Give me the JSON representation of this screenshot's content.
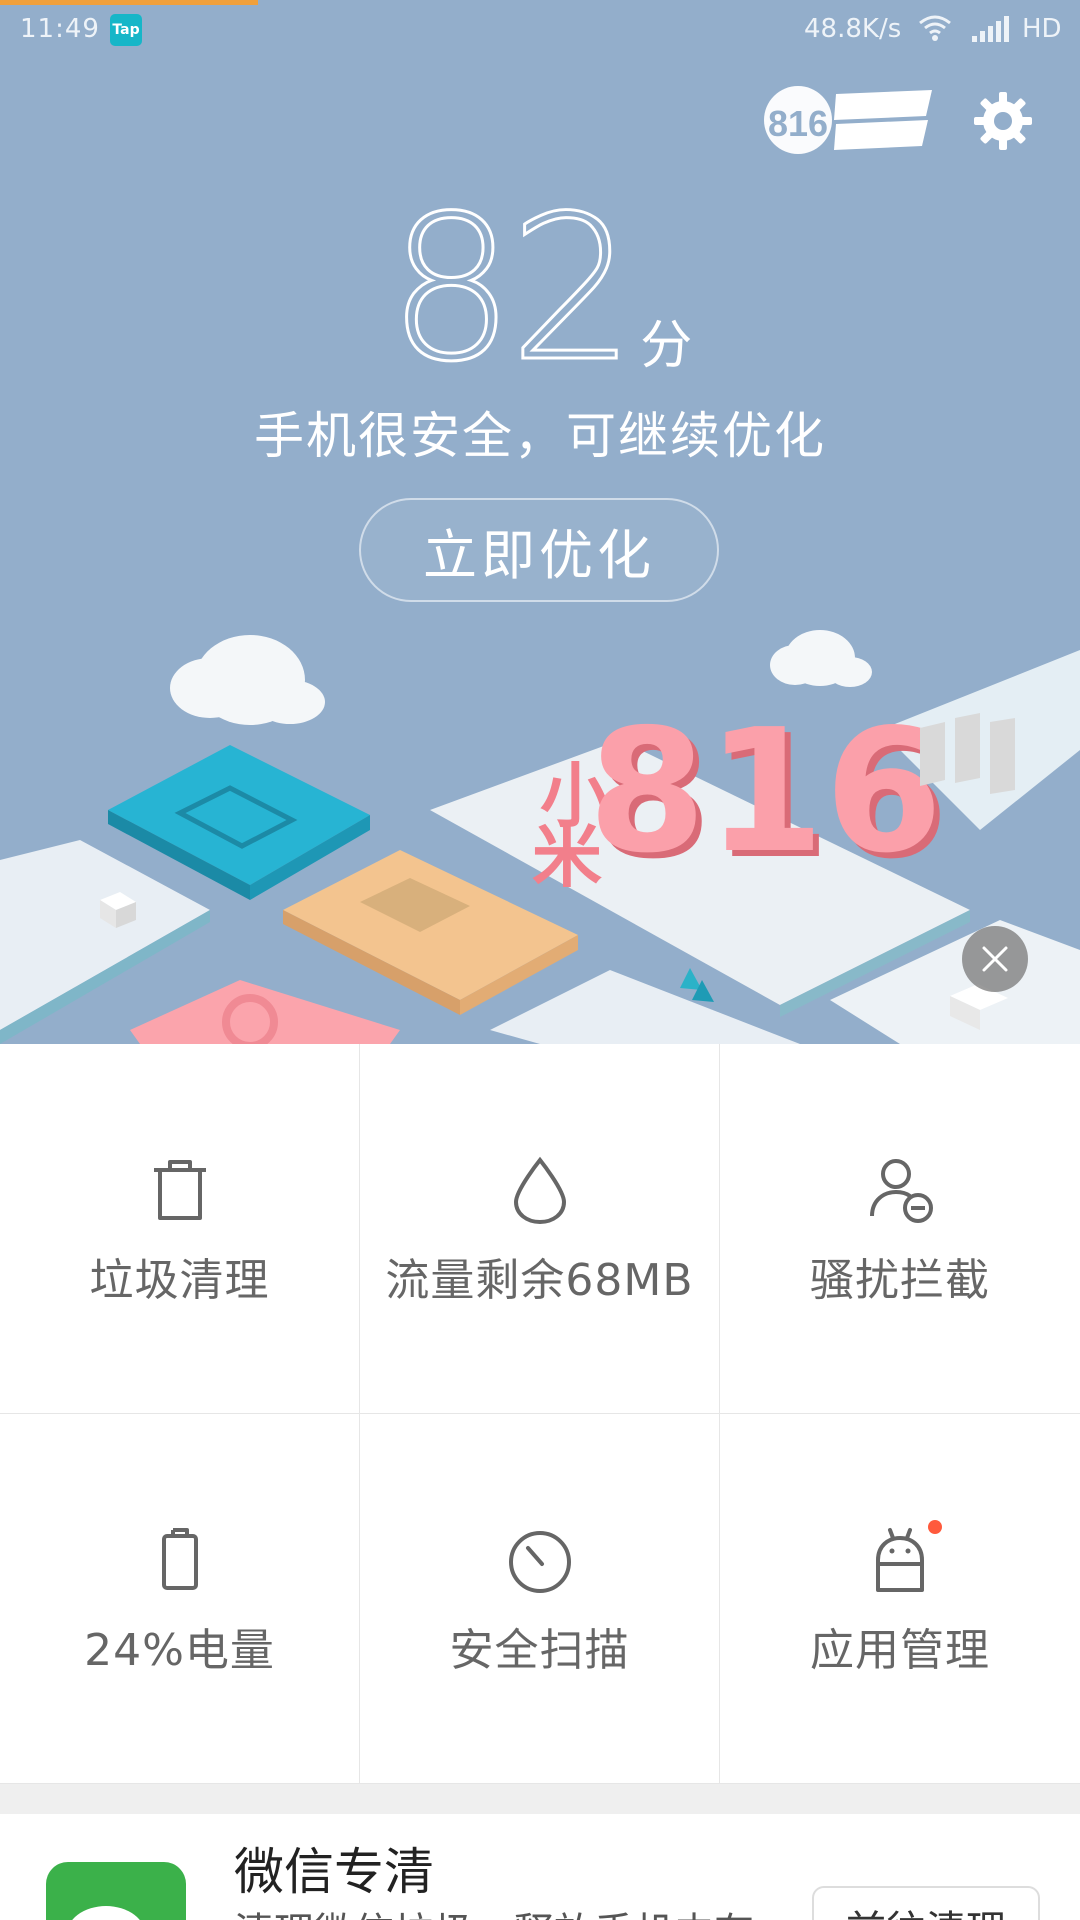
{
  "status_bar": {
    "time": "11:49",
    "tap_label": "Tap",
    "net_speed": "48.8K/s",
    "hd_label": "HD"
  },
  "header": {
    "promo_icon": "xiaomi-816-badge",
    "settings_icon": "gear-icon"
  },
  "score": {
    "value": "82",
    "unit": "分",
    "status": "手机很安全，可继续优化",
    "action_label": "立即优化"
  },
  "banner": {
    "title_text": "小米816",
    "close_icon": "close-icon"
  },
  "features": [
    {
      "label": "垃圾清理",
      "icon": "trash-icon"
    },
    {
      "label": "流量剩余68MB",
      "icon": "water-drop-icon"
    },
    {
      "label": "骚扰拦截",
      "icon": "user-block-icon"
    },
    {
      "label": "24%电量",
      "icon": "battery-icon"
    },
    {
      "label": "安全扫描",
      "icon": "scan-icon"
    },
    {
      "label": "应用管理",
      "icon": "android-icon"
    }
  ],
  "card": {
    "title": "微信专清",
    "subtitle": "清理微信垃圾，释放手机内存",
    "button_label": "前往清理",
    "icon": "wechat-icon"
  },
  "colors": {
    "hero_bg": "#93aecb",
    "accent_orange": "#f0a03c",
    "badge_red": "#ff5a3c",
    "wechat_green": "#3bb14a"
  }
}
